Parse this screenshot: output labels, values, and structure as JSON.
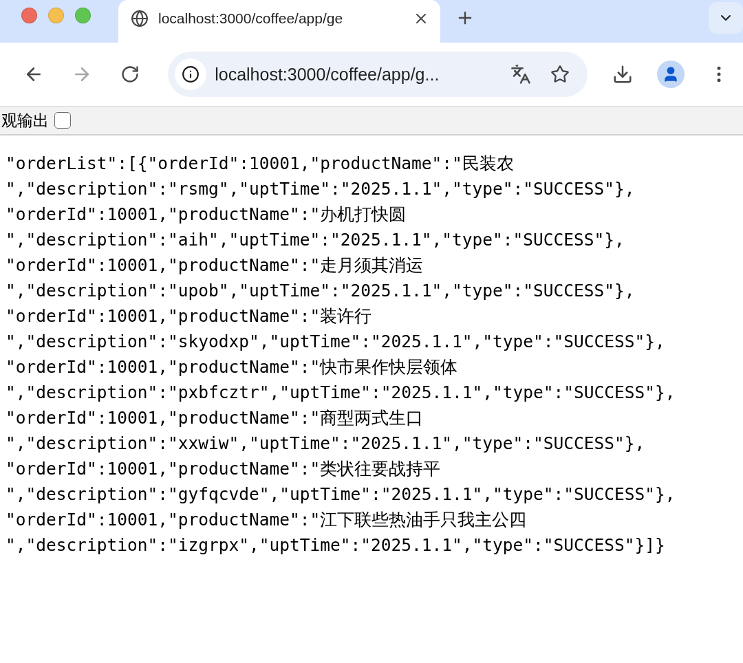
{
  "tab": {
    "title": "localhost:3000/coffee/app/ge",
    "selected": true
  },
  "address_bar": {
    "url": "localhost:3000/coffee/app/g..."
  },
  "toolbar": {
    "forward_disabled": true
  },
  "page": {
    "pretty_print": {
      "label": "观输出",
      "checked": false
    },
    "lines": [
      "\"orderList\":[{\"orderId\":10001,\"productName\":\"民装农",
      "\",\"description\":\"rsmg\",\"uptTime\":\"2025.1.1\",\"type\":\"SUCCESS\"},",
      "\"orderId\":10001,\"productName\":\"办机打快圆",
      "\",\"description\":\"aih\",\"uptTime\":\"2025.1.1\",\"type\":\"SUCCESS\"},",
      "\"orderId\":10001,\"productName\":\"走月须其消运",
      "\",\"description\":\"upob\",\"uptTime\":\"2025.1.1\",\"type\":\"SUCCESS\"},",
      "\"orderId\":10001,\"productName\":\"装许行",
      "\",\"description\":\"skyodxp\",\"uptTime\":\"2025.1.1\",\"type\":\"SUCCESS\"},",
      "\"orderId\":10001,\"productName\":\"快市果作快层领体",
      "\",\"description\":\"pxbfcztr\",\"uptTime\":\"2025.1.1\",\"type\":\"SUCCESS\"},",
      "\"orderId\":10001,\"productName\":\"商型两式生口",
      "\",\"description\":\"xxwiw\",\"uptTime\":\"2025.1.1\",\"type\":\"SUCCESS\"},",
      "\"orderId\":10001,\"productName\":\"类状往要战持平",
      "\",\"description\":\"gyfqcvde\",\"uptTime\":\"2025.1.1\",\"type\":\"SUCCESS\"},",
      "\"orderId\":10001,\"productName\":\"江下联些热油手只我主公四",
      "\",\"description\":\"izgrpx\",\"uptTime\":\"2025.1.1\",\"type\":\"SUCCESS\"}]}"
    ]
  }
}
